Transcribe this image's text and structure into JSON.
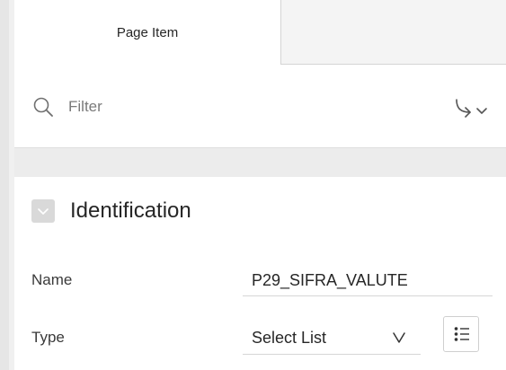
{
  "tabs": [
    {
      "label": "Page Item",
      "active": true
    },
    {
      "label": "",
      "active": false
    }
  ],
  "filter": {
    "placeholder": "Filter",
    "value": ""
  },
  "icons": {
    "search": "search-icon",
    "go_to_group": "go-to-group-icon",
    "collapse": "chevron-down-icon",
    "type_chevron": "chevron-down-icon",
    "list_values": "list-icon"
  },
  "section": {
    "title": "Identification",
    "expanded": true
  },
  "properties": {
    "name": {
      "label": "Name",
      "value": "P29_SIFRA_VALUTE"
    },
    "type": {
      "label": "Type",
      "value": "Select List"
    }
  },
  "colors": {
    "tab_inactive_bg": "#f4f4f4",
    "band_bg": "#ececec",
    "text": "#262626",
    "placeholder": "#7a7a7a"
  }
}
